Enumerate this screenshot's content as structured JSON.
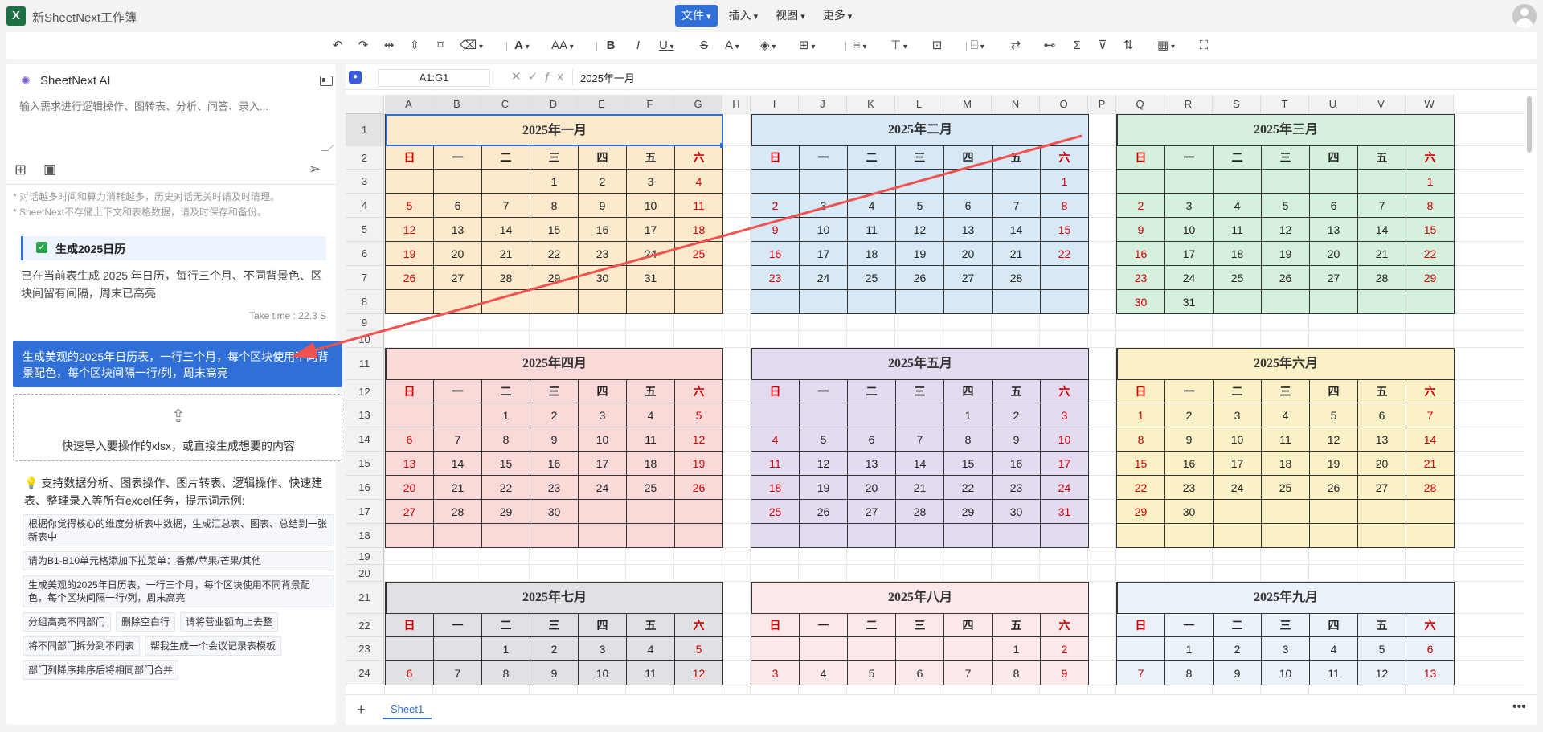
{
  "app": {
    "title": "新SheetNext工作簿",
    "logo": "X"
  },
  "menu": [
    {
      "label": "文件",
      "active": true
    },
    {
      "label": "插入",
      "active": false
    },
    {
      "label": "视图",
      "active": false
    },
    {
      "label": "更多",
      "active": false
    }
  ],
  "toolbar": {
    "icons": [
      "undo-icon",
      "redo-icon",
      "merge-h-icon",
      "merge-v-icon",
      "format-painter-icon",
      "eraser-icon",
      "font-icon",
      "font-size-icon",
      "bold-icon",
      "italic-icon",
      "underline-icon",
      "strikethrough-icon",
      "font-color-icon",
      "fill-color-icon",
      "border-icon",
      "align-h-icon",
      "align-v-icon",
      "wrap-icon",
      "conditional-format-icon",
      "find-replace-icon",
      "cell-format-icon",
      "sum-icon",
      "filter-icon",
      "sort-icon",
      "table-icon",
      "fullscreen-icon"
    ],
    "glyphs": {
      "bold": "B",
      "italic": "I",
      "underline": "U",
      "strike": "S",
      "fontcolor": "A",
      "font": "A",
      "fontsize": "AA",
      "sum": "Σ"
    }
  },
  "ai_panel": {
    "title": "SheetNext AI",
    "input_placeholder": "输入需求进行逻辑操作、图转表、分析、问答、录入...",
    "notes": [
      "* 对话越多时间和算力消耗越多，历史对话无关时请及时清理。",
      "* SheetNext不存储上下文和表格数据，请及时保存和备份。"
    ],
    "task": {
      "title": "生成2025日历",
      "description": "已在当前表生成 2025 年日历，每行三个月、不同背景色、区块间留有间隔，周末已高亮",
      "time": "Take time : 22.3 S"
    },
    "user_message": "生成美观的2025年日历表，一行三个月，每个区块使用不同背景配色，每个区块间隔一行/列，周末高亮",
    "import_text": "快速导入要操作的xlsx，或直接生成想要的内容",
    "tips_intro": "支持数据分析、图表操作、图片转表、逻辑操作、快速建表、整理录入等所有excel任务，提示词示例:",
    "examples": [
      "根据你觉得核心的维度分析表中数据，生成汇总表、图表、总结到一张新表中",
      "请为B1-B10单元格添加下拉菜单：香蕉/苹果/芒果/其他",
      "生成美观的2025年日历表，一行三个月，每个区块使用不同背景配色，每个区块间隔一行/列，周末高亮",
      "分组高亮不同部门",
      "删除空白行",
      "请将营业额向上去整",
      "将不同部门拆分到不同表",
      "帮我生成一个会议记录表模板",
      "部门列降序排序后将相同部门合并"
    ]
  },
  "formula_bar": {
    "name_box": "A1:G1",
    "formula": "2025年一月",
    "fx": "ƒx"
  },
  "sheet": {
    "columns": [
      "A",
      "B",
      "C",
      "D",
      "E",
      "F",
      "G",
      "H",
      "I",
      "J",
      "K",
      "L",
      "M",
      "N",
      "O",
      "P",
      "Q",
      "R",
      "S",
      "T",
      "U",
      "V",
      "W"
    ],
    "rows": [
      "1",
      "2",
      "3",
      "4",
      "5",
      "6",
      "7",
      "8",
      "9",
      "10",
      "11",
      "12",
      "13",
      "14",
      "15",
      "16",
      "17",
      "18",
      "19",
      "20",
      "21",
      "22",
      "23",
      "24"
    ],
    "weekdays": [
      "日",
      "一",
      "二",
      "三",
      "四",
      "五",
      "六"
    ],
    "months": [
      {
        "title": "2025年一月",
        "bg": "#fde9cc",
        "days": 31,
        "start": 3
      },
      {
        "title": "2025年二月",
        "bg": "#d7e8f7",
        "days": 28,
        "start": 6
      },
      {
        "title": "2025年三月",
        "bg": "#d5f0dc",
        "days": 31,
        "start": 6
      },
      {
        "title": "2025年四月",
        "bg": "#f9dad9",
        "days": 30,
        "start": 2
      },
      {
        "title": "2025年五月",
        "bg": "#e4dbf1",
        "days": 31,
        "start": 4
      },
      {
        "title": "2025年六月",
        "bg": "#faf1c7",
        "days": 30,
        "start": 0
      },
      {
        "title": "2025年七月",
        "bg": "#dfe1e4",
        "days": 31,
        "start": 2
      },
      {
        "title": "2025年八月",
        "bg": "#fce8e8",
        "days": 31,
        "start": 5
      },
      {
        "title": "2025年九月",
        "bg": "#eaf1f8",
        "days": 30,
        "start": 1
      }
    ]
  },
  "sheet_tabs": {
    "add": "+",
    "tabs": [
      "Sheet1"
    ],
    "more": "•••"
  },
  "colors": {
    "accent": "#2f6fd6",
    "weekend": "#d10000",
    "arrow": "#ef5350"
  }
}
